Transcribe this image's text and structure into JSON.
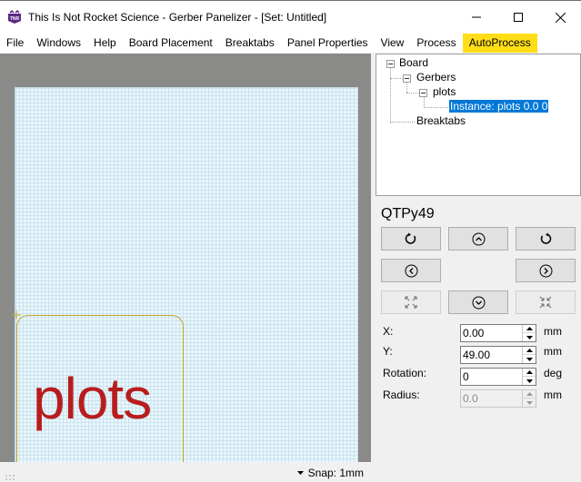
{
  "window": {
    "title": "This Is Not Rocket Science - Gerber Panelizer - [Set: Untitled]",
    "app_icon": "tinrs-logo-icon",
    "controls": [
      "minimize-icon",
      "maximize-icon",
      "close-icon"
    ]
  },
  "menu": {
    "items": [
      "File",
      "Windows",
      "Help",
      "Board Placement",
      "Breaktabs",
      "Panel Properties",
      "View",
      "Process",
      "AutoProcess"
    ],
    "highlight_color": "#ffde17"
  },
  "canvas": {
    "board_label": "plots",
    "board_label_color": "#b81d1d",
    "outline_color": "#c9a227"
  },
  "status": {
    "snap": "Snap: 1mm"
  },
  "tree": {
    "root": "Board",
    "gerbers": "Gerbers",
    "plots": "plots",
    "instance": "Instance: plots 0.0 0",
    "breaktabs": "Breaktabs"
  },
  "properties": {
    "board_name": "QTPy49",
    "buttons": {
      "rotate_cw": "rotate-cw-icon",
      "move_up": "chevron-up-icon",
      "rotate_ccw": "rotate-ccw-icon",
      "move_left": "chevron-left-icon",
      "move_right": "chevron-right-icon",
      "expand": "expand-icon",
      "move_down": "chevron-down-icon",
      "contract": "contract-icon"
    },
    "x_label": "X:",
    "x_value": "0.00",
    "x_unit": "mm",
    "y_label": "Y:",
    "y_value": "49.00",
    "y_unit": "mm",
    "rotation_label": "Rotation:",
    "rotation_value": "0",
    "rotation_unit": "deg",
    "radius_label": "Radius:",
    "radius_value": "0.0",
    "radius_unit": "mm"
  }
}
